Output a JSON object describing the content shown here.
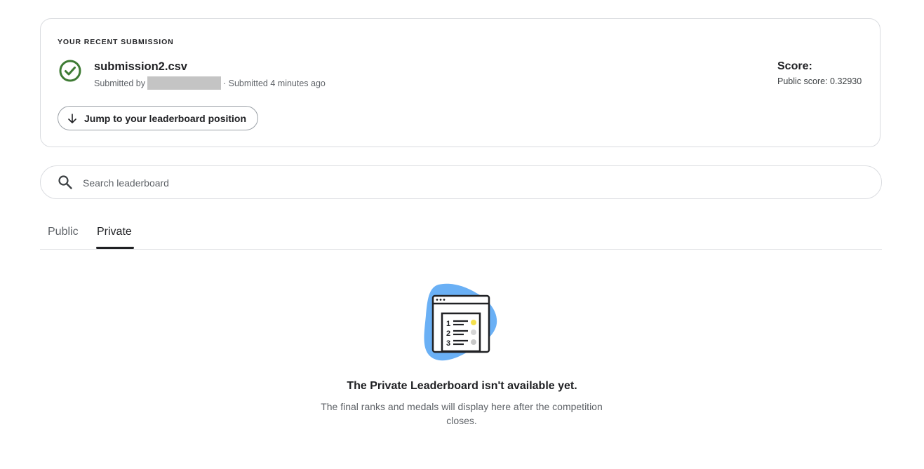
{
  "recent_submission": {
    "heading": "YOUR RECENT SUBMISSION",
    "file_name": "submission2.csv",
    "submitted_by_label": "Submitted by",
    "submitted_time": "· Submitted 4 minutes ago",
    "score_label": "Score:",
    "public_score": "Public score: 0.32930",
    "jump_button_label": "Jump to your leaderboard position",
    "status_icon": "check-circle-icon",
    "status_color": "#3e7b34"
  },
  "search": {
    "placeholder": "Search leaderboard",
    "icon": "search-icon"
  },
  "tabs": [
    {
      "label": "Public"
    },
    {
      "label": "Private",
      "selected": true
    }
  ],
  "empty_state": {
    "title": "The Private Leaderboard isn't available yet.",
    "description": "The final ranks and medals will display here after the competition closes.",
    "illustration_ranks": [
      "1",
      "2",
      "3"
    ],
    "illustration_color": "#6ab0f5"
  }
}
